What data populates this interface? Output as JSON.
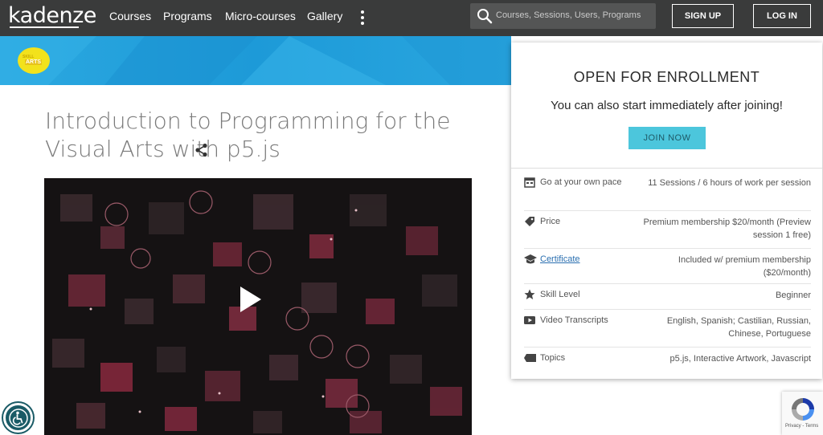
{
  "nav": {
    "logo": "kadenze",
    "links": [
      "Courses",
      "Programs",
      "Micro-courses",
      "Gallery"
    ],
    "search_placeholder": "Courses, Sessions, Users, Programs",
    "signup": "SIGN UP",
    "login": "LOG IN"
  },
  "banner": {
    "badge_top": "SKILL",
    "badge_main": "ARTS"
  },
  "course": {
    "title": "Introduction to Programming for the Visual Arts with p5.js"
  },
  "enrollment": {
    "heading": "OPEN FOR ENROLLMENT",
    "subheading": "You can also start immediately after joining!",
    "join_button": "JOIN NOW",
    "details": [
      {
        "icon": "calendar-icon",
        "label": "Go at your own pace",
        "value": "11 Sessions / 6 hours of work per session"
      },
      {
        "icon": "price-tag-icon",
        "label": "Price",
        "value": "Premium membership $20/month (Preview session 1 free)"
      },
      {
        "icon": "graduation-cap-icon",
        "label": "Certificate",
        "value": "Included w/ premium membership ($20/month)"
      },
      {
        "icon": "star-icon",
        "label": "Skill Level",
        "value": "Beginner"
      },
      {
        "icon": "video-icon",
        "label": "Video Transcripts",
        "value": "English, Spanish; Castilian, Russian, Chinese, Portuguese"
      },
      {
        "icon": "label-icon",
        "label": "Topics",
        "value": "p5.js, Interactive Artwork, Javascript"
      }
    ]
  },
  "recaptcha": {
    "footer": "Privacy - Terms"
  },
  "colors": {
    "nav_bg": "#3a3b3b",
    "banner_blue": "#1d9ad8",
    "join_button": "#4cc6dc",
    "link": "#2a6fb0"
  }
}
